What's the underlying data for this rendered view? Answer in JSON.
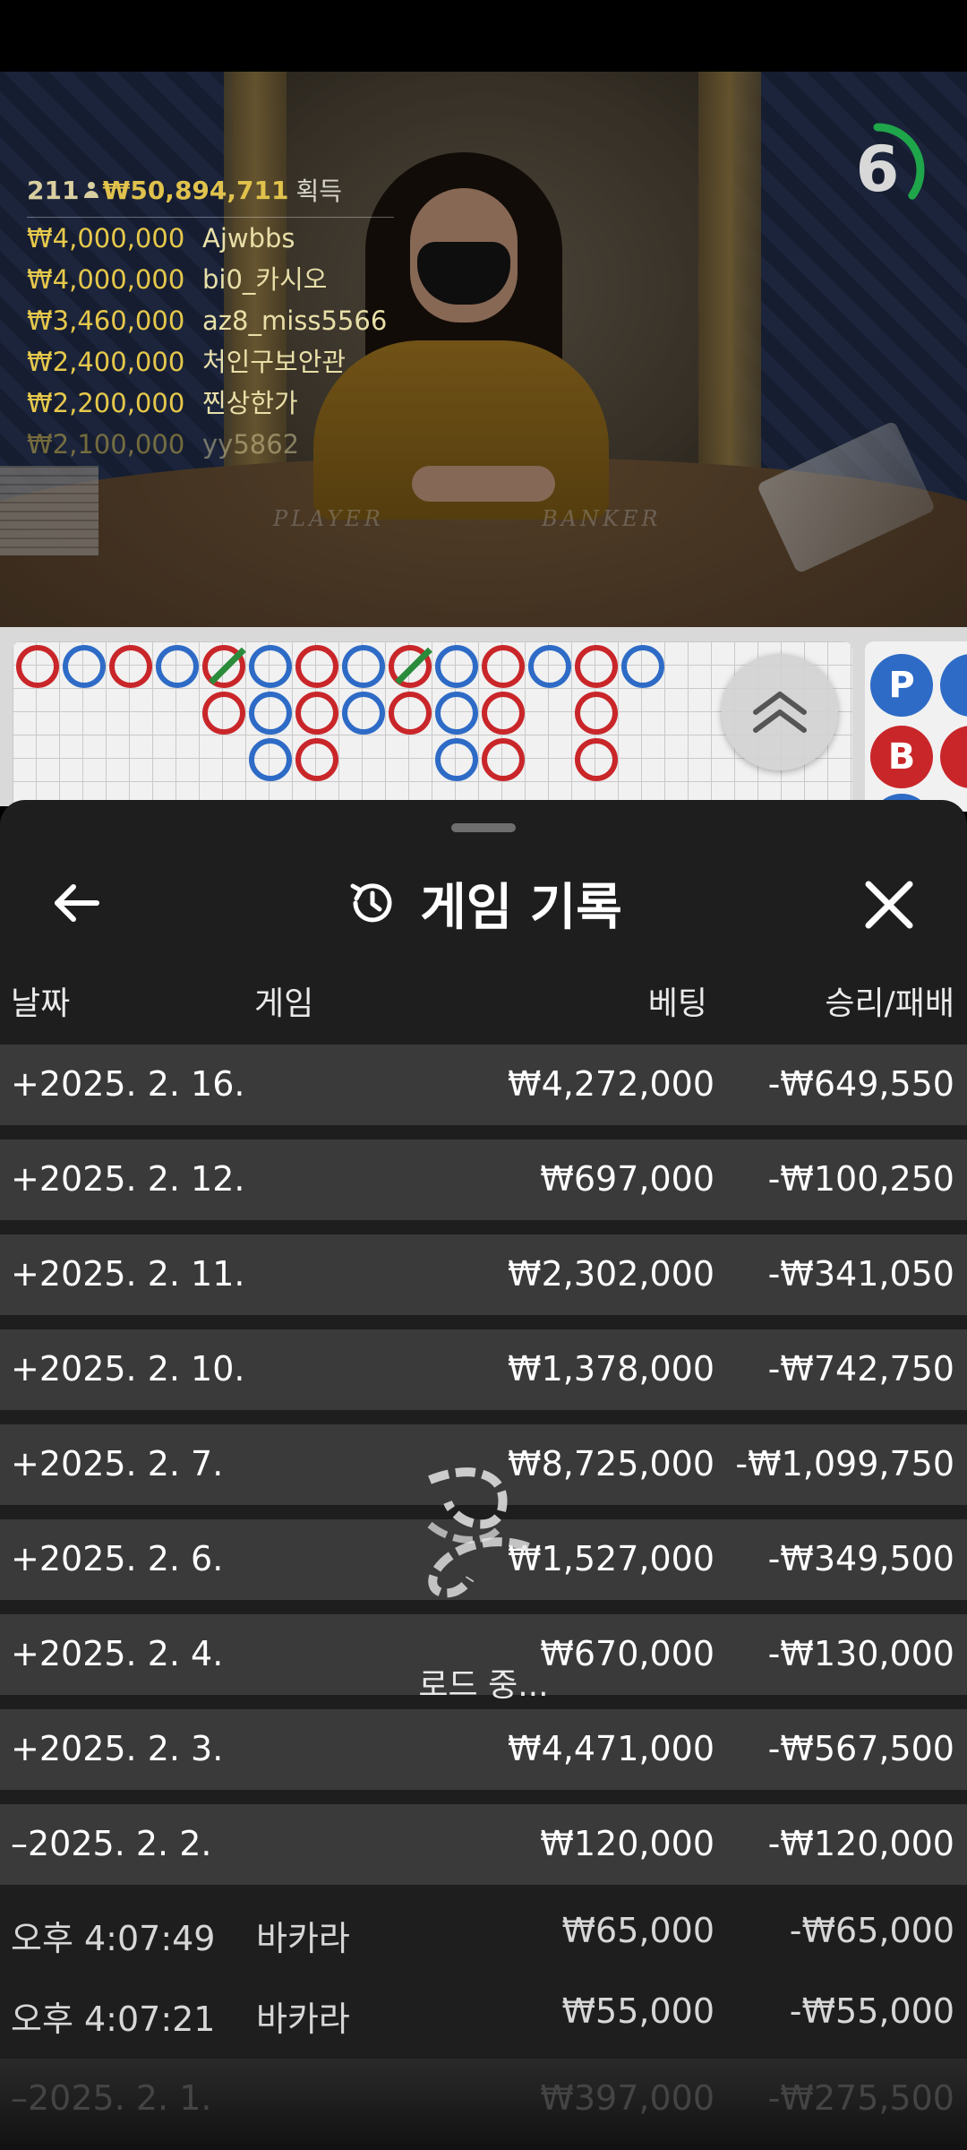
{
  "winners": {
    "players": "211",
    "total": "₩50,894,711",
    "label": "획득",
    "rows": [
      {
        "amount": "₩4,000,000",
        "name": "Ajwbbs"
      },
      {
        "amount": "₩4,000,000",
        "name": "bi0_카시오"
      },
      {
        "amount": "₩3,460,000",
        "name": "az8_miss5566"
      },
      {
        "amount": "₩2,400,000",
        "name": "처인구보안관"
      },
      {
        "amount": "₩2,200,000",
        "name": "찐상한가"
      },
      {
        "amount": "₩2,100,000",
        "name": "yy5862"
      }
    ]
  },
  "table_labels": {
    "player": "PLAYER",
    "banker": "BANKER"
  },
  "countdown": {
    "value": "6",
    "progress": 0.35
  },
  "prediction": {
    "player": "P",
    "banker": "B"
  },
  "sheet": {
    "title": "게임 기록",
    "columns": {
      "date": "날짜",
      "game": "게임",
      "bet": "베팅",
      "win_loss": "승리/패배"
    },
    "days": [
      {
        "date": "+2025. 2. 16.",
        "bet": "₩4,272,000",
        "win_loss": "-₩649,550"
      },
      {
        "date": "+2025. 2. 12.",
        "bet": "₩697,000",
        "win_loss": "-₩100,250"
      },
      {
        "date": "+2025. 2. 11.",
        "bet": "₩2,302,000",
        "win_loss": "-₩341,050"
      },
      {
        "date": "+2025. 2. 10.",
        "bet": "₩1,378,000",
        "win_loss": "-₩742,750"
      },
      {
        "date": "+2025. 2. 7.",
        "bet": "₩8,725,000",
        "win_loss": "-₩1,099,750"
      },
      {
        "date": "+2025. 2. 6.",
        "bet": "₩1,527,000",
        "win_loss": "-₩349,500"
      },
      {
        "date": "+2025. 2. 4.",
        "bet": "₩670,000",
        "win_loss": "-₩130,000"
      },
      {
        "date": "+2025. 2. 3.",
        "bet": "₩4,471,000",
        "win_loss": "-₩567,500"
      },
      {
        "date": "–2025. 2. 2.",
        "bet": "₩120,000",
        "win_loss": "-₩120,000"
      }
    ],
    "rounds": [
      {
        "time": "오후 4:07:49",
        "game": "바카라",
        "bet": "₩65,000",
        "win_loss": "-₩65,000"
      },
      {
        "time": "오후 4:07:21",
        "game": "바카라",
        "bet": "₩55,000",
        "win_loss": "-₩55,000"
      }
    ],
    "faded_row": {
      "date": "–2025. 2. 1.",
      "bet": "₩397,000",
      "win_loss": "-₩275,500"
    },
    "loading_text": "로드 중..."
  }
}
